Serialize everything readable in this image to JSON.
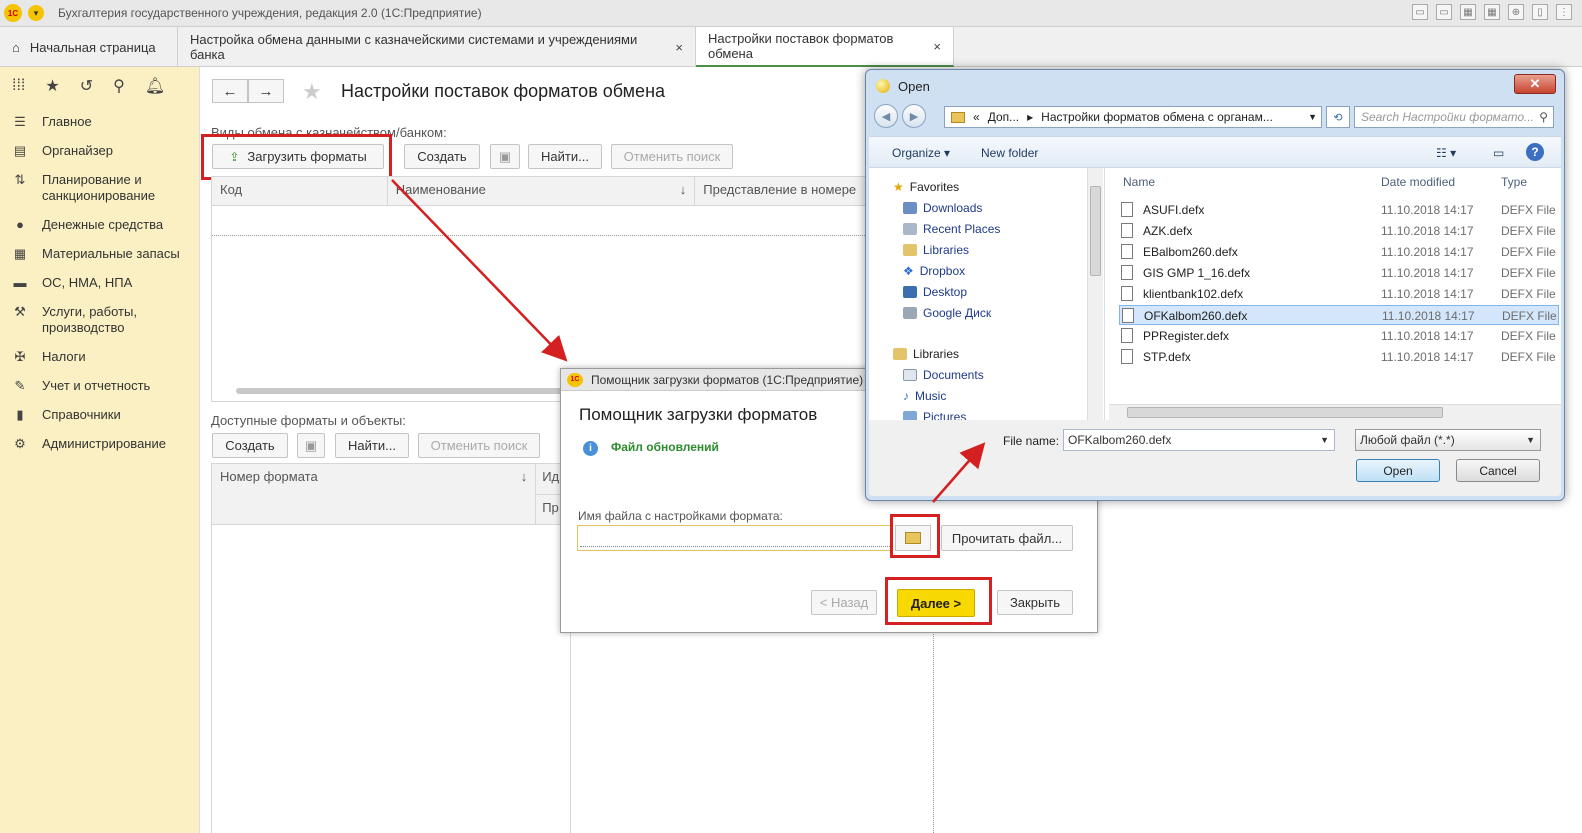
{
  "app": {
    "title": "Бухгалтерия государственного учреждения, редакция 2.0  (1С:Предприятие)",
    "logo": "1С"
  },
  "tabs": [
    {
      "label": "Начальная страница",
      "icon": "home-icon"
    },
    {
      "label": "Настройка обмена данными с казначейскими системами и учреждениями банка",
      "close": "×"
    },
    {
      "label": "Настройки поставок форматов обмена",
      "close": "×"
    }
  ],
  "sidebar": {
    "items": [
      {
        "label": "Главное",
        "icon": "menu-lines-icon"
      },
      {
        "label": "Органайзер",
        "icon": "organizer-icon"
      },
      {
        "label": "Планирование и санкционирование",
        "icon": "planning-icon"
      },
      {
        "label": "Денежные средства",
        "icon": "money-icon"
      },
      {
        "label": "Материальные запасы",
        "icon": "inventory-icon"
      },
      {
        "label": "ОС, НМА, НПА",
        "icon": "truck-icon"
      },
      {
        "label": "Услуги, работы, производство",
        "icon": "tools-icon"
      },
      {
        "label": "Налоги",
        "icon": "emblem-icon"
      },
      {
        "label": "Учет и отчетность",
        "icon": "accounting-icon"
      },
      {
        "label": "Справочники",
        "icon": "books-icon"
      },
      {
        "label": "Администрирование",
        "icon": "gear-icon"
      }
    ]
  },
  "main": {
    "title": "Настройки поставок форматов обмена",
    "section1_label": "Виды обмена с казначейством/банком:",
    "load_formats": "Загрузить форматы",
    "create": "Создать",
    "find": "Найти...",
    "cancel_search": "Отменить поиск",
    "grid1_cols": [
      "Код",
      "Наименование",
      "Представление в номере"
    ],
    "sort_arrow": "↓",
    "section2_label": "Доступные форматы и объекты:",
    "create2": "Создать",
    "find2": "Найти...",
    "cancel_search2": "Отменить поиск",
    "grid2_cols": [
      "Номер формата",
      "Ид",
      "Пр"
    ]
  },
  "assistant": {
    "window_title": "Помощник загрузки форматов  (1С:Предприятие)",
    "heading": "Помощник загрузки форматов",
    "info": "Файл обновлений",
    "file_label": "Имя файла с настройками формата:",
    "read_file": "Прочитать файл...",
    "back": "< Назад",
    "next": "Далее >",
    "close": "Закрыть"
  },
  "open_dialog": {
    "title": "Open",
    "close": "✕",
    "path": [
      "Доп...",
      "Настройки форматов обмена с органам..."
    ],
    "search_placeholder": "Search Настройки формато...",
    "organize": "Organize ▾",
    "new_folder": "New folder",
    "tree": [
      {
        "label": "Favorites",
        "head": true
      },
      {
        "label": "Downloads"
      },
      {
        "label": "Recent Places"
      },
      {
        "label": "Libraries"
      },
      {
        "label": "Dropbox"
      },
      {
        "label": "Desktop"
      },
      {
        "label": "Google Диск"
      },
      {
        "label": "Libraries",
        "head": true
      },
      {
        "label": "Documents"
      },
      {
        "label": "Music"
      },
      {
        "label": "Pictures"
      }
    ],
    "columns": [
      "Name",
      "Date modified",
      "Type"
    ],
    "files": [
      {
        "name": "ASUFI.defx",
        "date": "11.10.2018 14:17",
        "type": "DEFX File"
      },
      {
        "name": "AZK.defx",
        "date": "11.10.2018 14:17",
        "type": "DEFX File"
      },
      {
        "name": "EBalbom260.defx",
        "date": "11.10.2018 14:17",
        "type": "DEFX File"
      },
      {
        "name": "GIS GMP 1_16.defx",
        "date": "11.10.2018 14:17",
        "type": "DEFX File"
      },
      {
        "name": "klientbank102.defx",
        "date": "11.10.2018 14:17",
        "type": "DEFX File"
      },
      {
        "name": "OFKalbom260.defx",
        "date": "11.10.2018 14:17",
        "type": "DEFX File",
        "selected": true
      },
      {
        "name": "PPRegister.defx",
        "date": "11.10.2018 14:17",
        "type": "DEFX File"
      },
      {
        "name": "STP.defx",
        "date": "11.10.2018 14:17",
        "type": "DEFX File"
      }
    ],
    "file_name_label": "File name:",
    "file_name_value": "OFKalbom260.defx",
    "filter": "Любой файл (*.*)",
    "open": "Open",
    "cancel": "Cancel"
  },
  "colors": {
    "highlight": "#d42020",
    "sidebar": "#fbf0c3",
    "primary_button": "#f7d800"
  }
}
